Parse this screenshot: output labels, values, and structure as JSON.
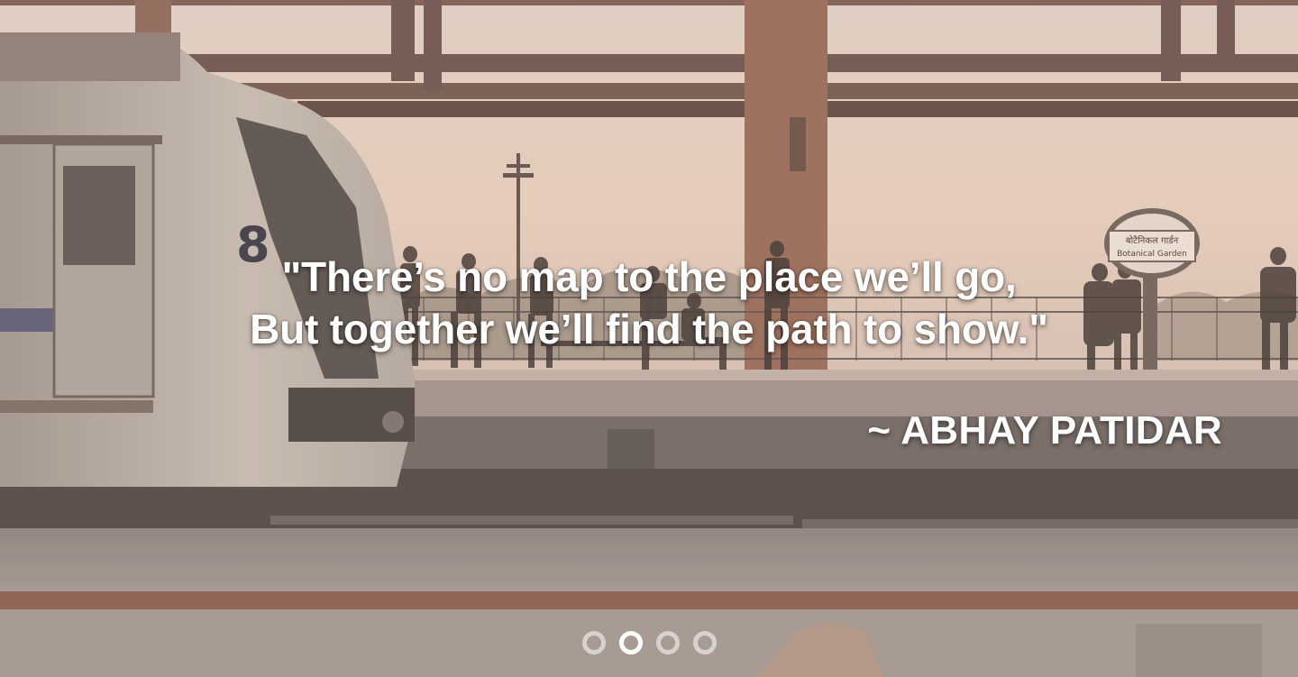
{
  "slider": {
    "quote_line_1": "\"There’s no map to the place we’ll go,",
    "quote_line_2": "But together we’ll find the path to show.\"",
    "author": "~ ABHAY PATIDAR",
    "slide_count": 4,
    "active_slide_index": 1
  },
  "background": {
    "station_sign_line_1": "बोटैनिकल गार्डन",
    "station_sign_line_2": "Botanical Garden",
    "train_number": "8"
  },
  "colors": {
    "text": "#ffffff",
    "dot_inactive": "rgba(255,255,255,0.55)",
    "dot_active": "#ffffff",
    "sky": "#e9d4c6",
    "steel": "#6b5a52"
  }
}
